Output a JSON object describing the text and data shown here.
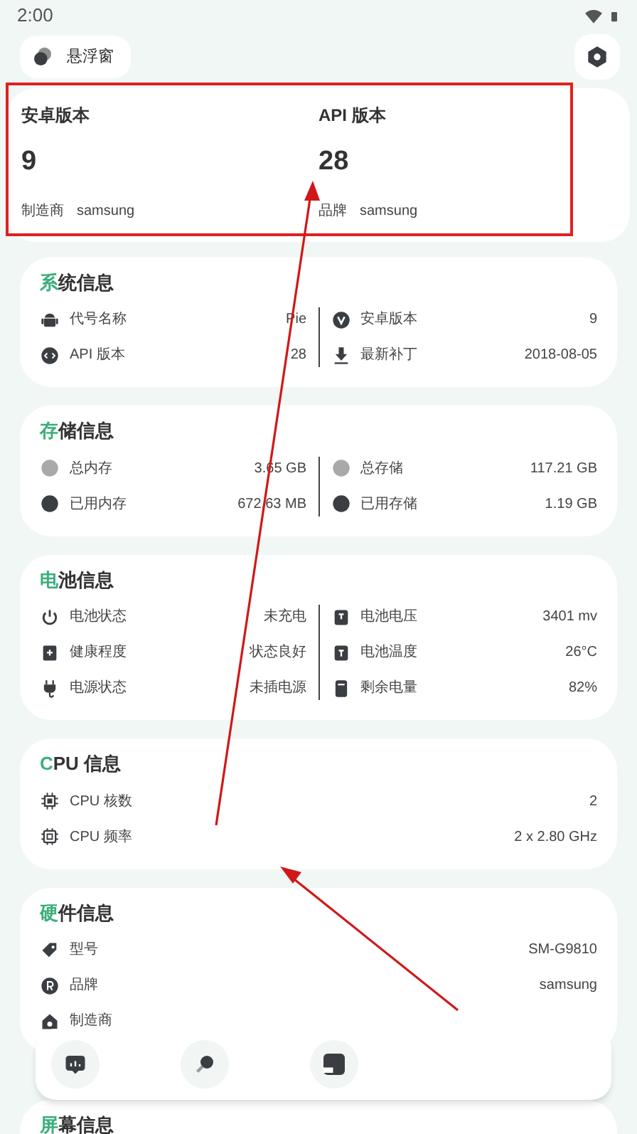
{
  "status_bar": {
    "time": "2:00"
  },
  "header": {
    "float_button": "悬浮窗"
  },
  "summary": [
    {
      "title": "安卓版本",
      "value": "9",
      "footer_label": "制造商",
      "footer_value": "samsung"
    },
    {
      "title": "API 版本",
      "value": "28",
      "footer_label": "品牌",
      "footer_value": "samsung"
    }
  ],
  "sections": [
    {
      "title": "系统信息",
      "columns": [
        [
          {
            "label": "代号名称",
            "value": "Pie"
          },
          {
            "label": "API 版本",
            "value": "28"
          }
        ],
        [
          {
            "label": "安卓版本",
            "value": "9"
          },
          {
            "label": "最新补丁",
            "value": "2018-08-05"
          }
        ]
      ]
    },
    {
      "title": "存储信息",
      "columns": [
        [
          {
            "label": "总内存",
            "value": "3.65 GB"
          },
          {
            "label": "已用内存",
            "value": "672.63 MB"
          }
        ],
        [
          {
            "label": "总存储",
            "value": "117.21 GB"
          },
          {
            "label": "已用存储",
            "value": "1.19 GB"
          }
        ]
      ]
    },
    {
      "title": "电池信息",
      "columns": [
        [
          {
            "label": "电池状态",
            "value": "未充电"
          },
          {
            "label": "健康程度",
            "value": "状态良好"
          },
          {
            "label": "电源状态",
            "value": "未插电源"
          }
        ],
        [
          {
            "label": "电池电压",
            "value": "3401 mv"
          },
          {
            "label": "电池温度",
            "value": "26°C"
          },
          {
            "label": "剩余电量",
            "value": "82%"
          }
        ]
      ]
    },
    {
      "title": "CPU 信息",
      "rows": [
        {
          "label": "CPU 核数",
          "value": "2"
        },
        {
          "label": "CPU 频率",
          "value": "2 x 2.80 GHz"
        }
      ]
    },
    {
      "title": "硬件信息",
      "rows": [
        {
          "label": "型号",
          "value": "SM-G9810"
        },
        {
          "label": "品牌",
          "value": "samsung"
        },
        {
          "label": "制造商"
        }
      ]
    },
    {
      "title": "屏幕信息"
    }
  ]
}
